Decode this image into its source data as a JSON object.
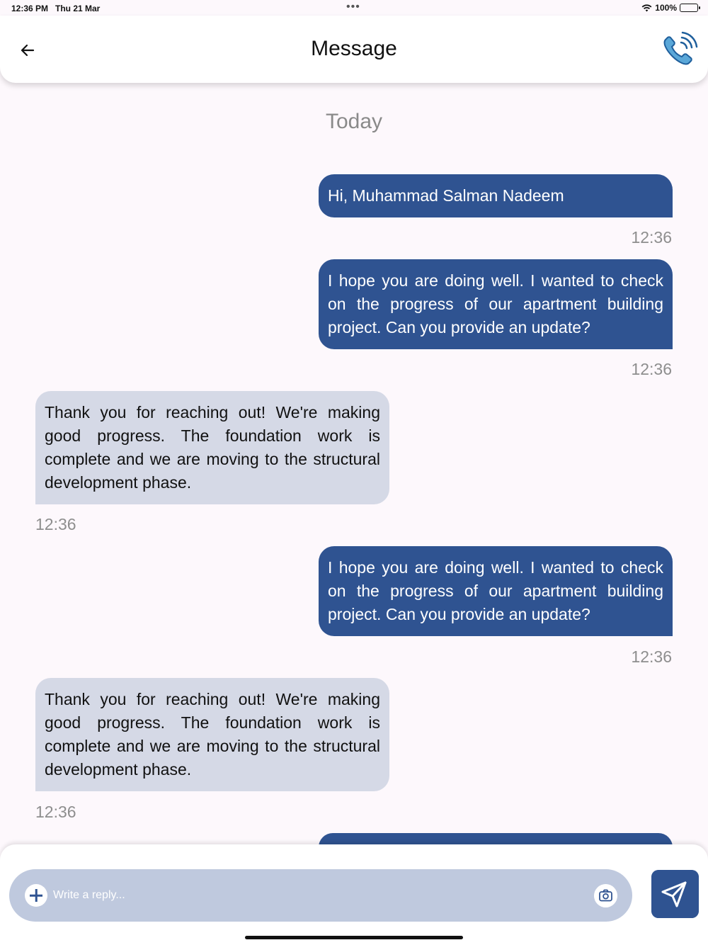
{
  "status_bar": {
    "time": "12:36 PM",
    "date": "Thu 21 Mar",
    "battery": "100%"
  },
  "header": {
    "title": "Message",
    "back_icon": "arrow-left-icon",
    "call_icon": "phone-call-icon"
  },
  "chat": {
    "day_label": "Today",
    "messages": [
      {
        "direction": "out",
        "text": "Hi, Muhammad Salman Nadeem",
        "time": "12:36"
      },
      {
        "direction": "out",
        "text": "I hope you are doing well. I wanted to check on the progress of our apartment building project. Can you provide an update?",
        "time": "12:36"
      },
      {
        "direction": "in",
        "text": "Thank you for reaching out! We're making good progress. The foundation work is complete and we are moving to the structural development phase.",
        "time": "12:36"
      },
      {
        "direction": "out",
        "text": "I hope you are doing well. I wanted to check on the progress of our apartment building project. Can you provide an update?",
        "time": "12:36"
      },
      {
        "direction": "in",
        "text": "Thank you for reaching out! We're making good progress. The foundation work is complete and we are moving to the structural development phase.",
        "time": "12:36"
      }
    ]
  },
  "composer": {
    "placeholder": "Write a reply...",
    "value": "",
    "add_icon": "plus-icon",
    "camera_icon": "camera-icon",
    "send_icon": "send-icon"
  },
  "colors": {
    "accent": "#2f5391",
    "incoming_bubble": "#d5d9e6",
    "input_bg": "#bfc9de",
    "background": "#fdf8fc"
  }
}
